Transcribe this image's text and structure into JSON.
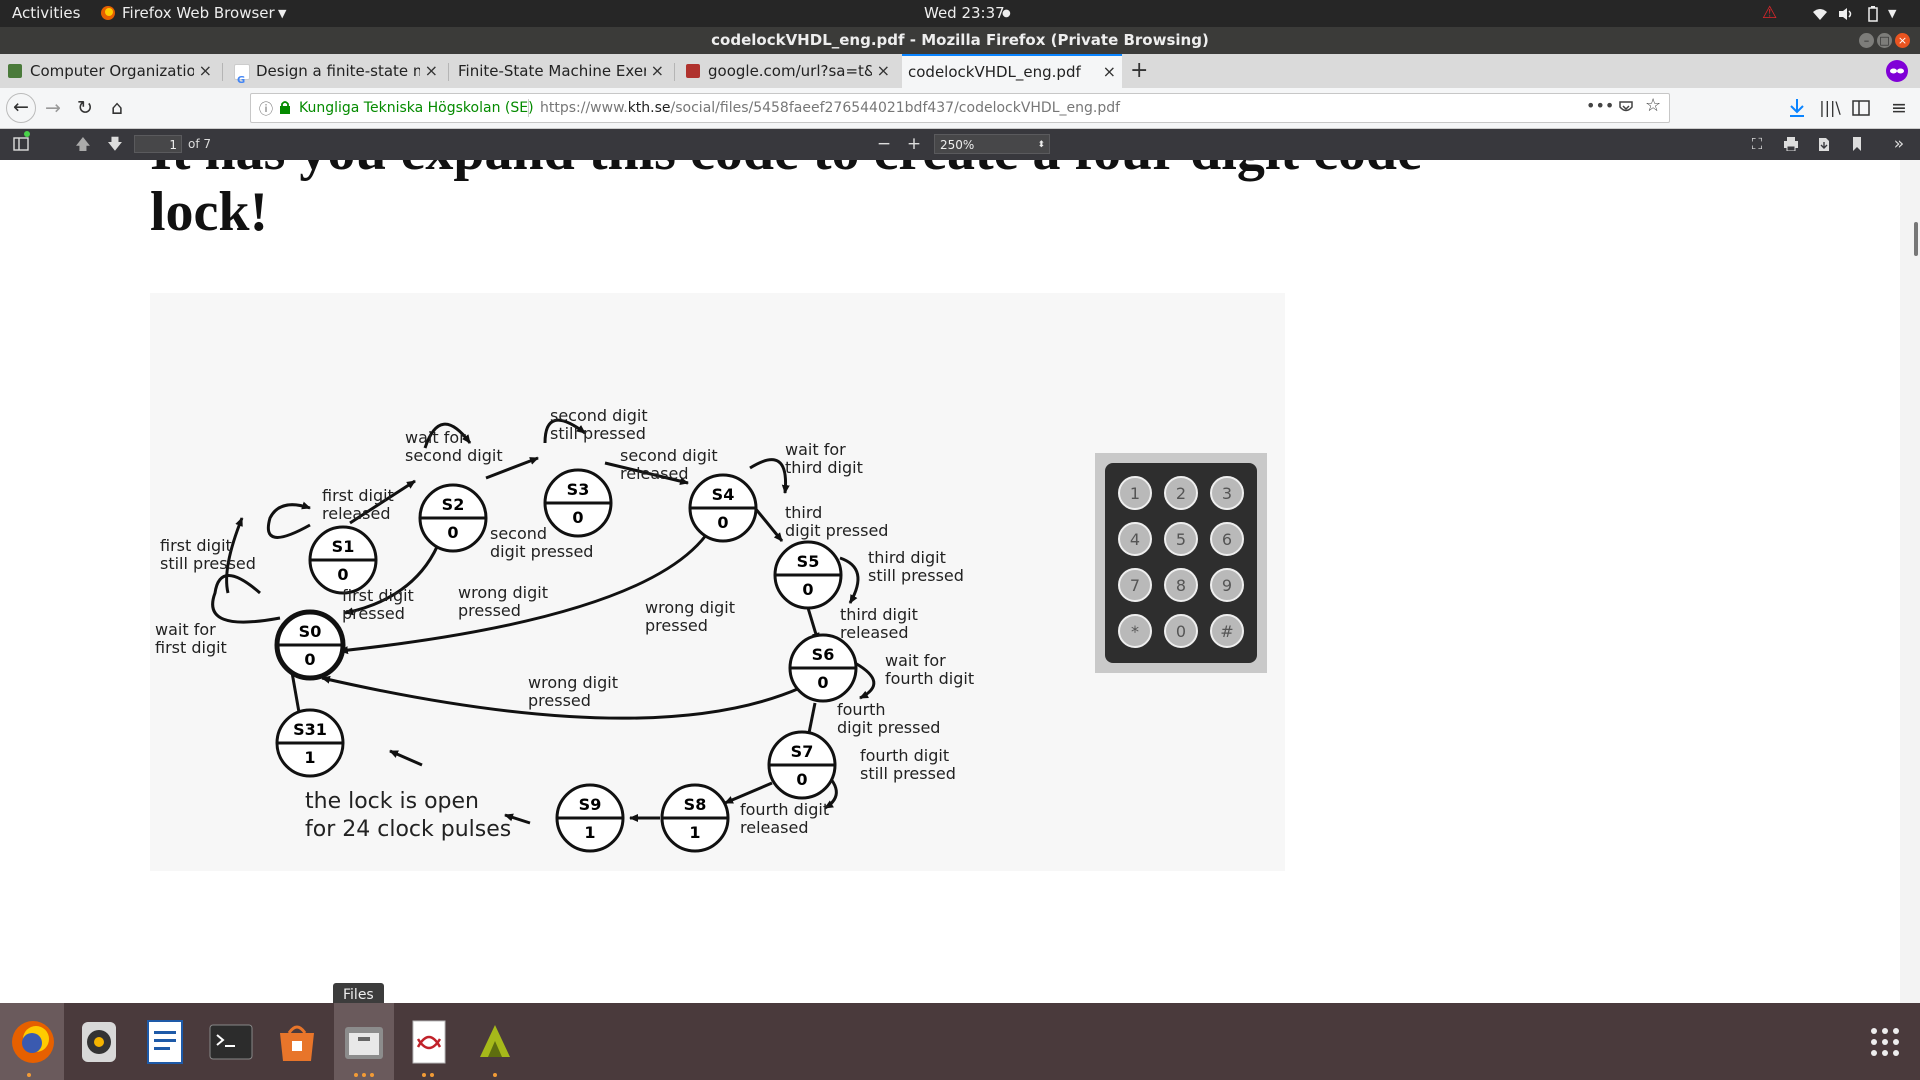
{
  "topbar": {
    "activities": "Activities",
    "app_menu": "Firefox Web Browser",
    "clock": "Wed 23:37"
  },
  "window": {
    "title": "codelockVHDL_eng.pdf - Mozilla Firefox (Private Browsing)"
  },
  "tabs": [
    {
      "label": "Computer Organization",
      "icon_color": "#4a7a3a"
    },
    {
      "label": "Design a finite-state mac",
      "icon_color": "#4285f4"
    },
    {
      "label": "Finite-State Machine Exercis",
      "icon_color": "#f5f6f7"
    },
    {
      "label": "google.com/url?sa=t&rct",
      "icon_color": "#b0322d"
    },
    {
      "label": "codelockVHDL_eng.pdf",
      "icon_color": "#f5f6f7"
    }
  ],
  "tab_close": "×",
  "new_tab": "+",
  "urlbar": {
    "site_identity": "Kungliga Tekniska Högskolan (SE)",
    "url_prefix": "https://www.",
    "url_domain": "kth.se",
    "url_path": "/social/files/5458faeef276544021bdf437/codelockVHDL_eng.pdf"
  },
  "pdf_toolbar": {
    "page_number": "1",
    "page_count": "of 7",
    "zoom": "250%",
    "zoom_out": "−",
    "zoom_in": "+"
  },
  "document": {
    "heading_partial": "It has you expand this code to create a four digit code",
    "heading_line2": "lock!"
  },
  "diagram": {
    "states": [
      {
        "name": "S0",
        "out": "0"
      },
      {
        "name": "S1",
        "out": "0"
      },
      {
        "name": "S2",
        "out": "0"
      },
      {
        "name": "S3",
        "out": "0"
      },
      {
        "name": "S4",
        "out": "0"
      },
      {
        "name": "S5",
        "out": "0"
      },
      {
        "name": "S6",
        "out": "0"
      },
      {
        "name": "S7",
        "out": "0"
      },
      {
        "name": "S8",
        "out": "1"
      },
      {
        "name": "S9",
        "out": "1"
      },
      {
        "name": "S31",
        "out": "1"
      }
    ],
    "labels": {
      "wait_second_1": "wait for",
      "wait_second_2": "second digit",
      "second_still_1": "second digit",
      "second_still_2": "still pressed",
      "second_released_1": "second digit",
      "second_released_2": "released",
      "wait_third_1": "wait for",
      "wait_third_2": "third digit",
      "first_released_1": "first digit",
      "first_released_2": "released",
      "first_still_1": "first digit",
      "first_still_2": "still pressed",
      "second_pressed_1": "second",
      "second_pressed_2": "digit pressed",
      "third_pressed_1": "third",
      "third_pressed_2": "digit pressed",
      "third_still_1": "third digit",
      "third_still_2": "still pressed",
      "first_pressed_1": "first digit",
      "first_pressed_2": "pressed",
      "wrong1_1": "wrong digit",
      "wrong1_2": "pressed",
      "wrong2_1": "wrong digit",
      "wrong2_2": "pressed",
      "wrong3_1": "wrong digit",
      "wrong3_2": "pressed",
      "wait_first_1": "wait for",
      "wait_first_2": "first digit",
      "third_released_1": "third digit",
      "third_released_2": "released",
      "wait_fourth_1": "wait for",
      "wait_fourth_2": "fourth digit",
      "fourth_pressed_1": "fourth",
      "fourth_pressed_2": "digit pressed",
      "fourth_still_1": "fourth digit",
      "fourth_still_2": "still pressed",
      "fourth_released_1": "fourth digit",
      "fourth_released_2": "released",
      "open_1": "the lock is open",
      "open_2": "for  24 clock pulses"
    },
    "keypad_keys": [
      "1",
      "2",
      "3",
      "4",
      "5",
      "6",
      "7",
      "8",
      "9",
      "*",
      "0",
      "#"
    ]
  },
  "tooltip": "Files",
  "colors": {
    "topbar": "#262626",
    "titlebar": "#3b3b39",
    "pdf_toolbar": "#38383d",
    "dock": "#4a3a3c",
    "accent": "#0a84ff",
    "secure_green": "#058b00",
    "running_dot": "#f29b36"
  },
  "dock_apps": [
    {
      "name": "firefox-icon"
    },
    {
      "name": "rhythmbox-icon"
    },
    {
      "name": "writer-icon"
    },
    {
      "name": "terminal-icon"
    },
    {
      "name": "software-icon"
    },
    {
      "name": "files-icon"
    },
    {
      "name": "evince-icon"
    },
    {
      "name": "app-icon"
    },
    {
      "name": "show-apps-icon"
    }
  ]
}
